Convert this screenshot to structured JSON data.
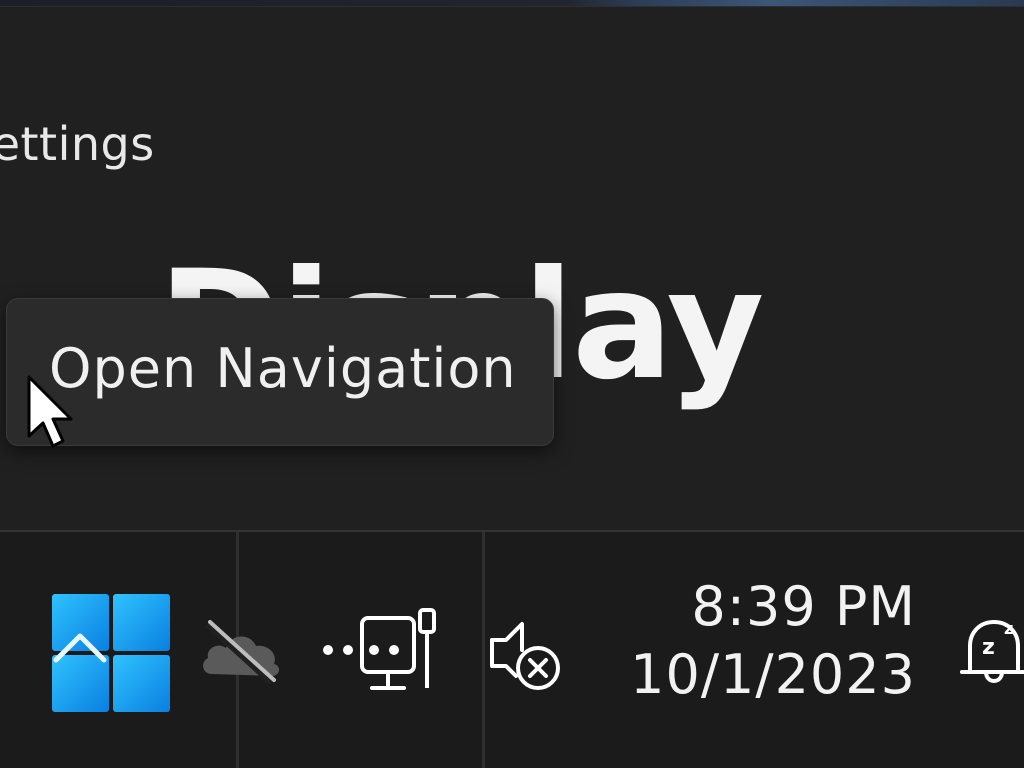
{
  "window": {
    "app_title": "Settings",
    "page_heading": "Display"
  },
  "tooltip": {
    "text": "Open Navigation"
  },
  "taskbar": {
    "icons": [
      {
        "name": "start-icon"
      },
      {
        "name": "onedrive-offline-icon"
      },
      {
        "name": "network-ethernet-icon"
      },
      {
        "name": "volume-muted-icon"
      },
      {
        "name": "notifications-do-not-disturb-icon"
      }
    ],
    "clock": {
      "time": "8:39 PM",
      "date": "10/1/2023"
    }
  },
  "colors": {
    "window_bg": "#202020",
    "taskbar_bg": "#1b1b1b",
    "tooltip_bg": "#2b2b2b",
    "start_blue": "#1aa7f0"
  }
}
